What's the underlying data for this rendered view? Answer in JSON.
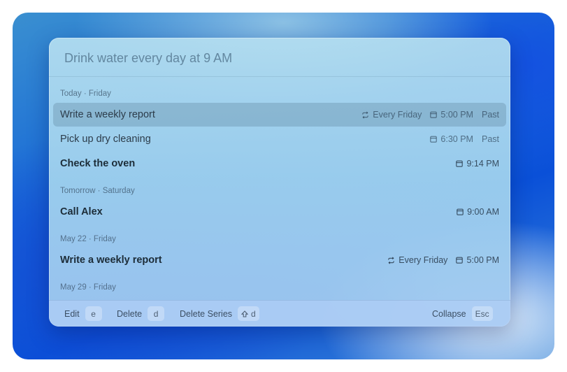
{
  "search": {
    "placeholder": "Drink water every day at 9 AM",
    "value": ""
  },
  "sections": [
    {
      "label": "Today · Friday"
    },
    {
      "label": "Tomorrow · Saturday"
    },
    {
      "label": "May 22 · Friday"
    },
    {
      "label": "May 29 · Friday"
    }
  ],
  "reminders": [
    {
      "title": "Write a weekly report",
      "recurrence": "Every Friday",
      "time": "5:00 PM",
      "status": "Past",
      "selected": true
    },
    {
      "title": "Pick up dry cleaning",
      "time": "6:30 PM",
      "status": "Past"
    },
    {
      "title": "Check the oven",
      "time": "9:14 PM"
    },
    {
      "title": "Call Alex",
      "time": "9:00 AM"
    },
    {
      "title": "Write a weekly report",
      "recurrence": "Every Friday",
      "time": "5:00 PM"
    }
  ],
  "footer": {
    "edit": {
      "label": "Edit",
      "key": "e"
    },
    "delete": {
      "label": "Delete",
      "key": "d"
    },
    "delete_series": {
      "label": "Delete Series",
      "key": "d",
      "modifier_icon": "shift-icon"
    },
    "collapse": {
      "label": "Collapse",
      "key": "Esc"
    }
  },
  "icons": {
    "recurrence": "repeat-icon",
    "time": "calendar-icon"
  }
}
